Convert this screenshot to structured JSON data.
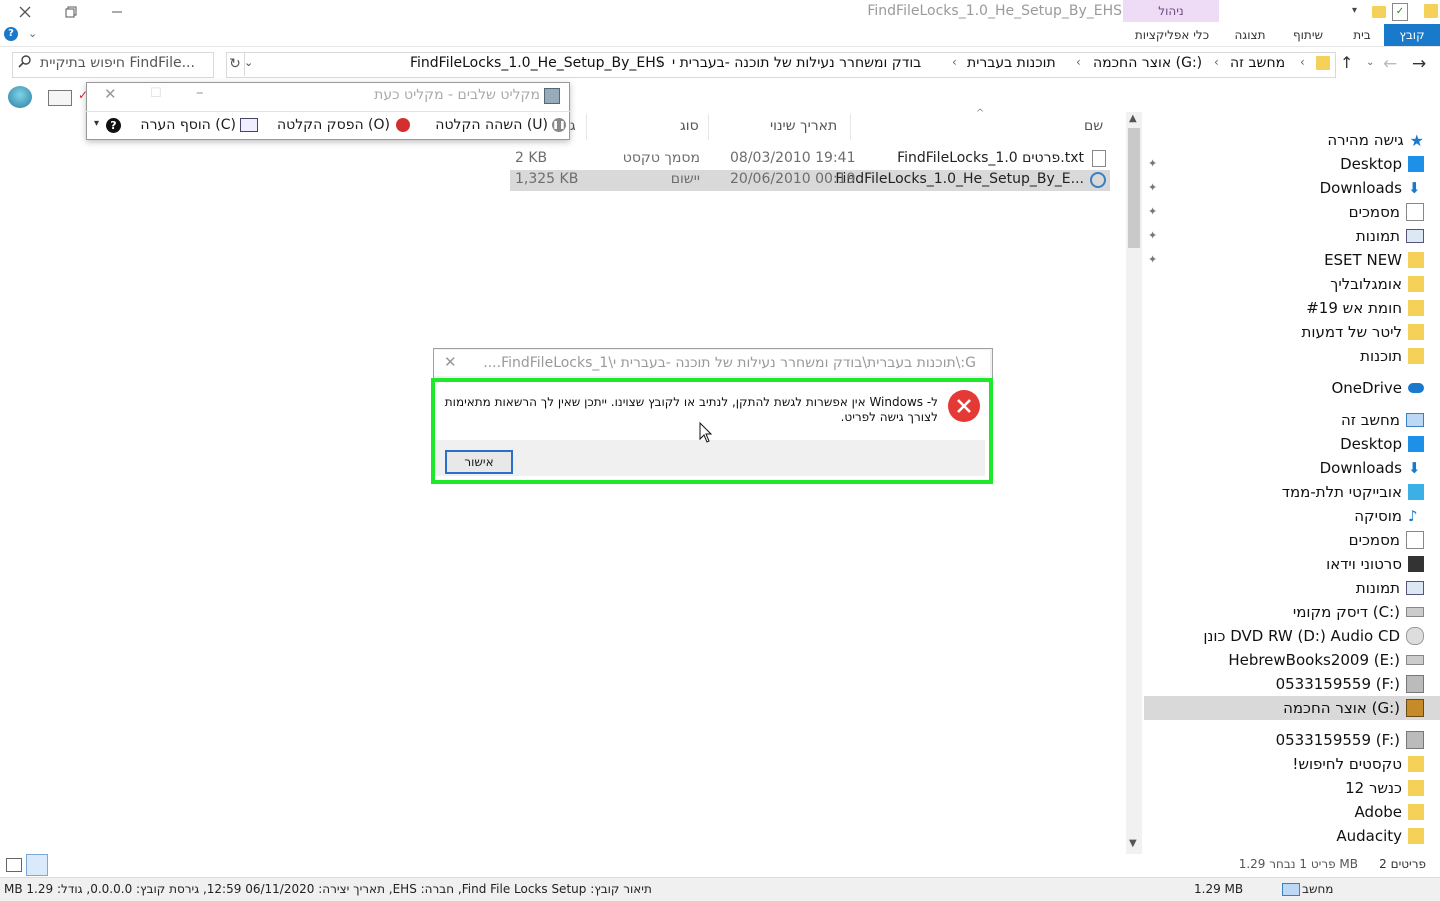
{
  "window": {
    "title": "FindFileLocks_1.0_He_Setup_By_EHS",
    "manage_label": "ניהול",
    "app_tools_label": "כלי אפליקציות"
  },
  "ribbon": {
    "tabs": [
      "קובץ",
      "בית",
      "שיתוף",
      "תצוגה"
    ]
  },
  "address": {
    "crumbs": [
      "מחשב זה",
      "אוצר החכמה (G:)",
      "תוכנות בעברית",
      "בודק ומשחרר נעילות של תוכנה -בעברית י",
      "FindFileLocks_1.0_He_Setup_By_EHS"
    ],
    "search_placeholder": "חיפוש בתיקיית FindFile..."
  },
  "recorder": {
    "title": "מקליט שלבים - מקליט כעת",
    "pause_label": "השהה הקלטה (U)",
    "stop_label": "הפסק הקלטה (O)",
    "comment_label": "הוסף הערה (C)"
  },
  "columns": {
    "name": "שם",
    "date": "תאריך שינוי",
    "type": "סוג",
    "size": "גו"
  },
  "files": [
    {
      "name": "FindFileLocks_1.0 פרטים.txt",
      "date": "08/03/2010 19:41",
      "type": "מסמך טקסט",
      "size": "2 KB",
      "selected": false
    },
    {
      "name": "FindFileLocks_1.0_He_Setup_By_E...",
      "date": "20/06/2010 00:19",
      "type": "יישום",
      "size": "1,325 KB",
      "selected": true
    }
  ],
  "nav": {
    "quick_access": "גישה מהירה",
    "items": [
      {
        "label": "Desktop",
        "icon": "desktop-icon"
      },
      {
        "label": "Downloads",
        "icon": "download-icon"
      },
      {
        "label": "מסמכים",
        "icon": "documents-icon"
      },
      {
        "label": "תמונות",
        "icon": "pictures-icon"
      },
      {
        "label": "ESET NEW",
        "icon": "folder-icon"
      },
      {
        "label": "אומגלובליך",
        "icon": "folder-icon"
      },
      {
        "label": "חומת אש #19",
        "icon": "folder-icon"
      },
      {
        "label": "ליטר של דמעות",
        "icon": "folder-icon"
      },
      {
        "label": "תוכנות",
        "icon": "folder-icon"
      },
      {
        "label": "OneDrive",
        "icon": "cloud-icon"
      },
      {
        "label": "מחשב זה",
        "icon": "computer-icon"
      },
      {
        "label": "Desktop",
        "icon": "desktop-icon"
      },
      {
        "label": "Downloads",
        "icon": "download-icon"
      },
      {
        "label": "אובייקטי תלת-ממד",
        "icon": "cube-icon"
      },
      {
        "label": "מוסיקה",
        "icon": "music-icon"
      },
      {
        "label": "מסמכים",
        "icon": "documents-icon"
      },
      {
        "label": "סרטוני וידאו",
        "icon": "video-icon"
      },
      {
        "label": "תמונות",
        "icon": "pictures-icon"
      },
      {
        "label": "דיסק מקומי (C:)",
        "icon": "drive-icon"
      },
      {
        "label": "כונן DVD RW (D:) Audio CD",
        "icon": "dvd-icon"
      },
      {
        "label": "HebrewBooks2009 (E:)",
        "icon": "drive-icon"
      },
      {
        "label": "0533159559 (F:)",
        "icon": "usb-drive-icon"
      },
      {
        "label": "אוצר החכמה (G:)",
        "icon": "otzar-drive-icon"
      },
      {
        "label": "0533159559 (F:)",
        "icon": "usb-drive-icon"
      },
      {
        "label": "!טקסטים לחיפוש",
        "icon": "folder-icon"
      },
      {
        "label": "12 כנשר",
        "icon": "folder-icon"
      },
      {
        "label": "Adobe",
        "icon": "folder-icon"
      },
      {
        "label": "Audacity",
        "icon": "folder-icon"
      }
    ]
  },
  "dialog": {
    "title": "G:\\תוכנות בעברית\\בודק ומשחרר נעילות של תוכנה -בעברית י\\FindFileLocks_1....",
    "message_line1": "ל- Windows אין אפשרות לגשת להתקן, לנתיב או לקובץ שצוינו. ייתכן שאין לך הרשאות מתאימות",
    "message_line2": "לצורך גישה לפריט.",
    "ok_label": "אישור"
  },
  "status": {
    "items_count": "2 פריטים",
    "selected_info": "פריט 1 נבחר  1.29 MB",
    "details": "תיאור קובץ: Find File Locks Setup, חברה: EHS, תאריך יצירה: 06/11/2020 12:59, גירסת קובץ: 0.0.0.0, גודל: 1.29 MB",
    "size": "1.29 MB",
    "computer_label": "מחשב"
  },
  "colors": {
    "accent": "#1979ca",
    "highlight_frame": "#1ee82a",
    "selection": "#d9d9d9",
    "error_red": "#e53935"
  }
}
